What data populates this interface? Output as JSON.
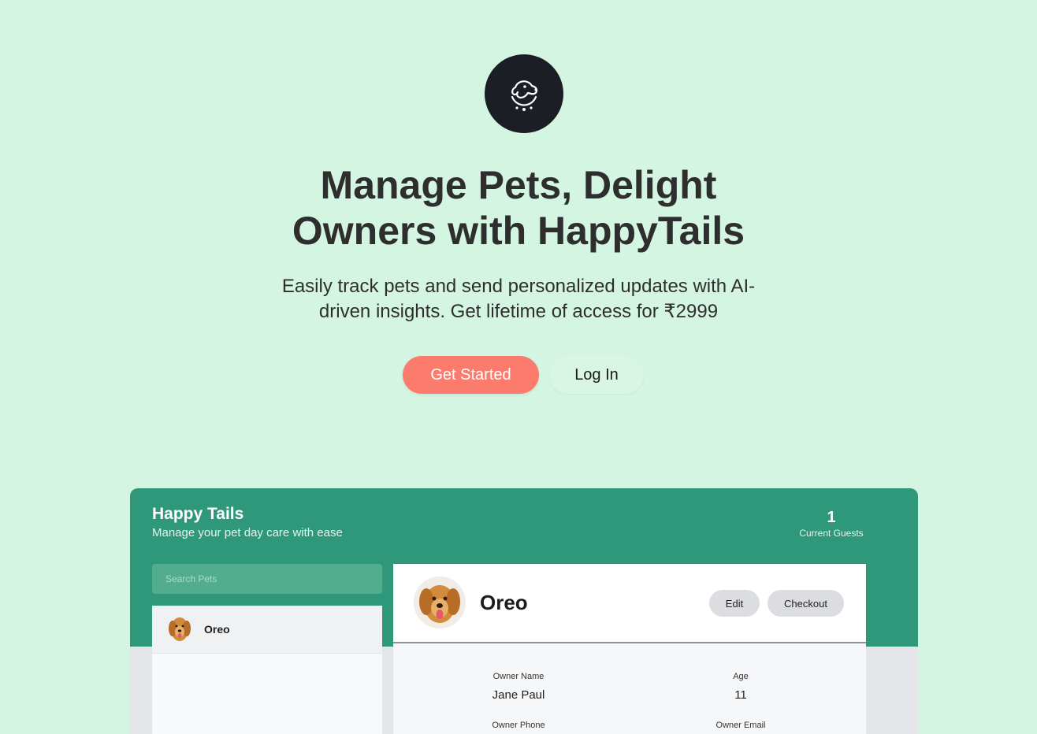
{
  "hero": {
    "logo_icon": "dog-icon",
    "title_line1": "Manage Pets, Delight",
    "title_line2": "Owners with HappyTails",
    "subtitle_line1": "Easily track pets and send personalized updates with AI-",
    "subtitle_line2": "driven insights. Get lifetime of access for ₹2999",
    "primary_button": "Get Started",
    "secondary_button": "Log In"
  },
  "app": {
    "title": "Happy Tails",
    "tagline": "Manage your pet day care with ease",
    "guests_count": "1",
    "guests_label": "Current Guests",
    "search_placeholder": "Search Pets",
    "pets": [
      {
        "name": "Oreo"
      }
    ],
    "selected_pet": {
      "name": "Oreo",
      "edit_label": "Edit",
      "checkout_label": "Checkout",
      "fields": [
        {
          "label": "Owner Name",
          "value": "Jane Paul"
        },
        {
          "label": "Age",
          "value": "11"
        },
        {
          "label": "Owner Phone",
          "value": ""
        },
        {
          "label": "Owner Email",
          "value": ""
        }
      ]
    }
  },
  "colors": {
    "background": "#d4f5e1",
    "accent": "#fb7c6c",
    "app_header": "#2f987a",
    "logo_bg": "#1b1e24"
  }
}
